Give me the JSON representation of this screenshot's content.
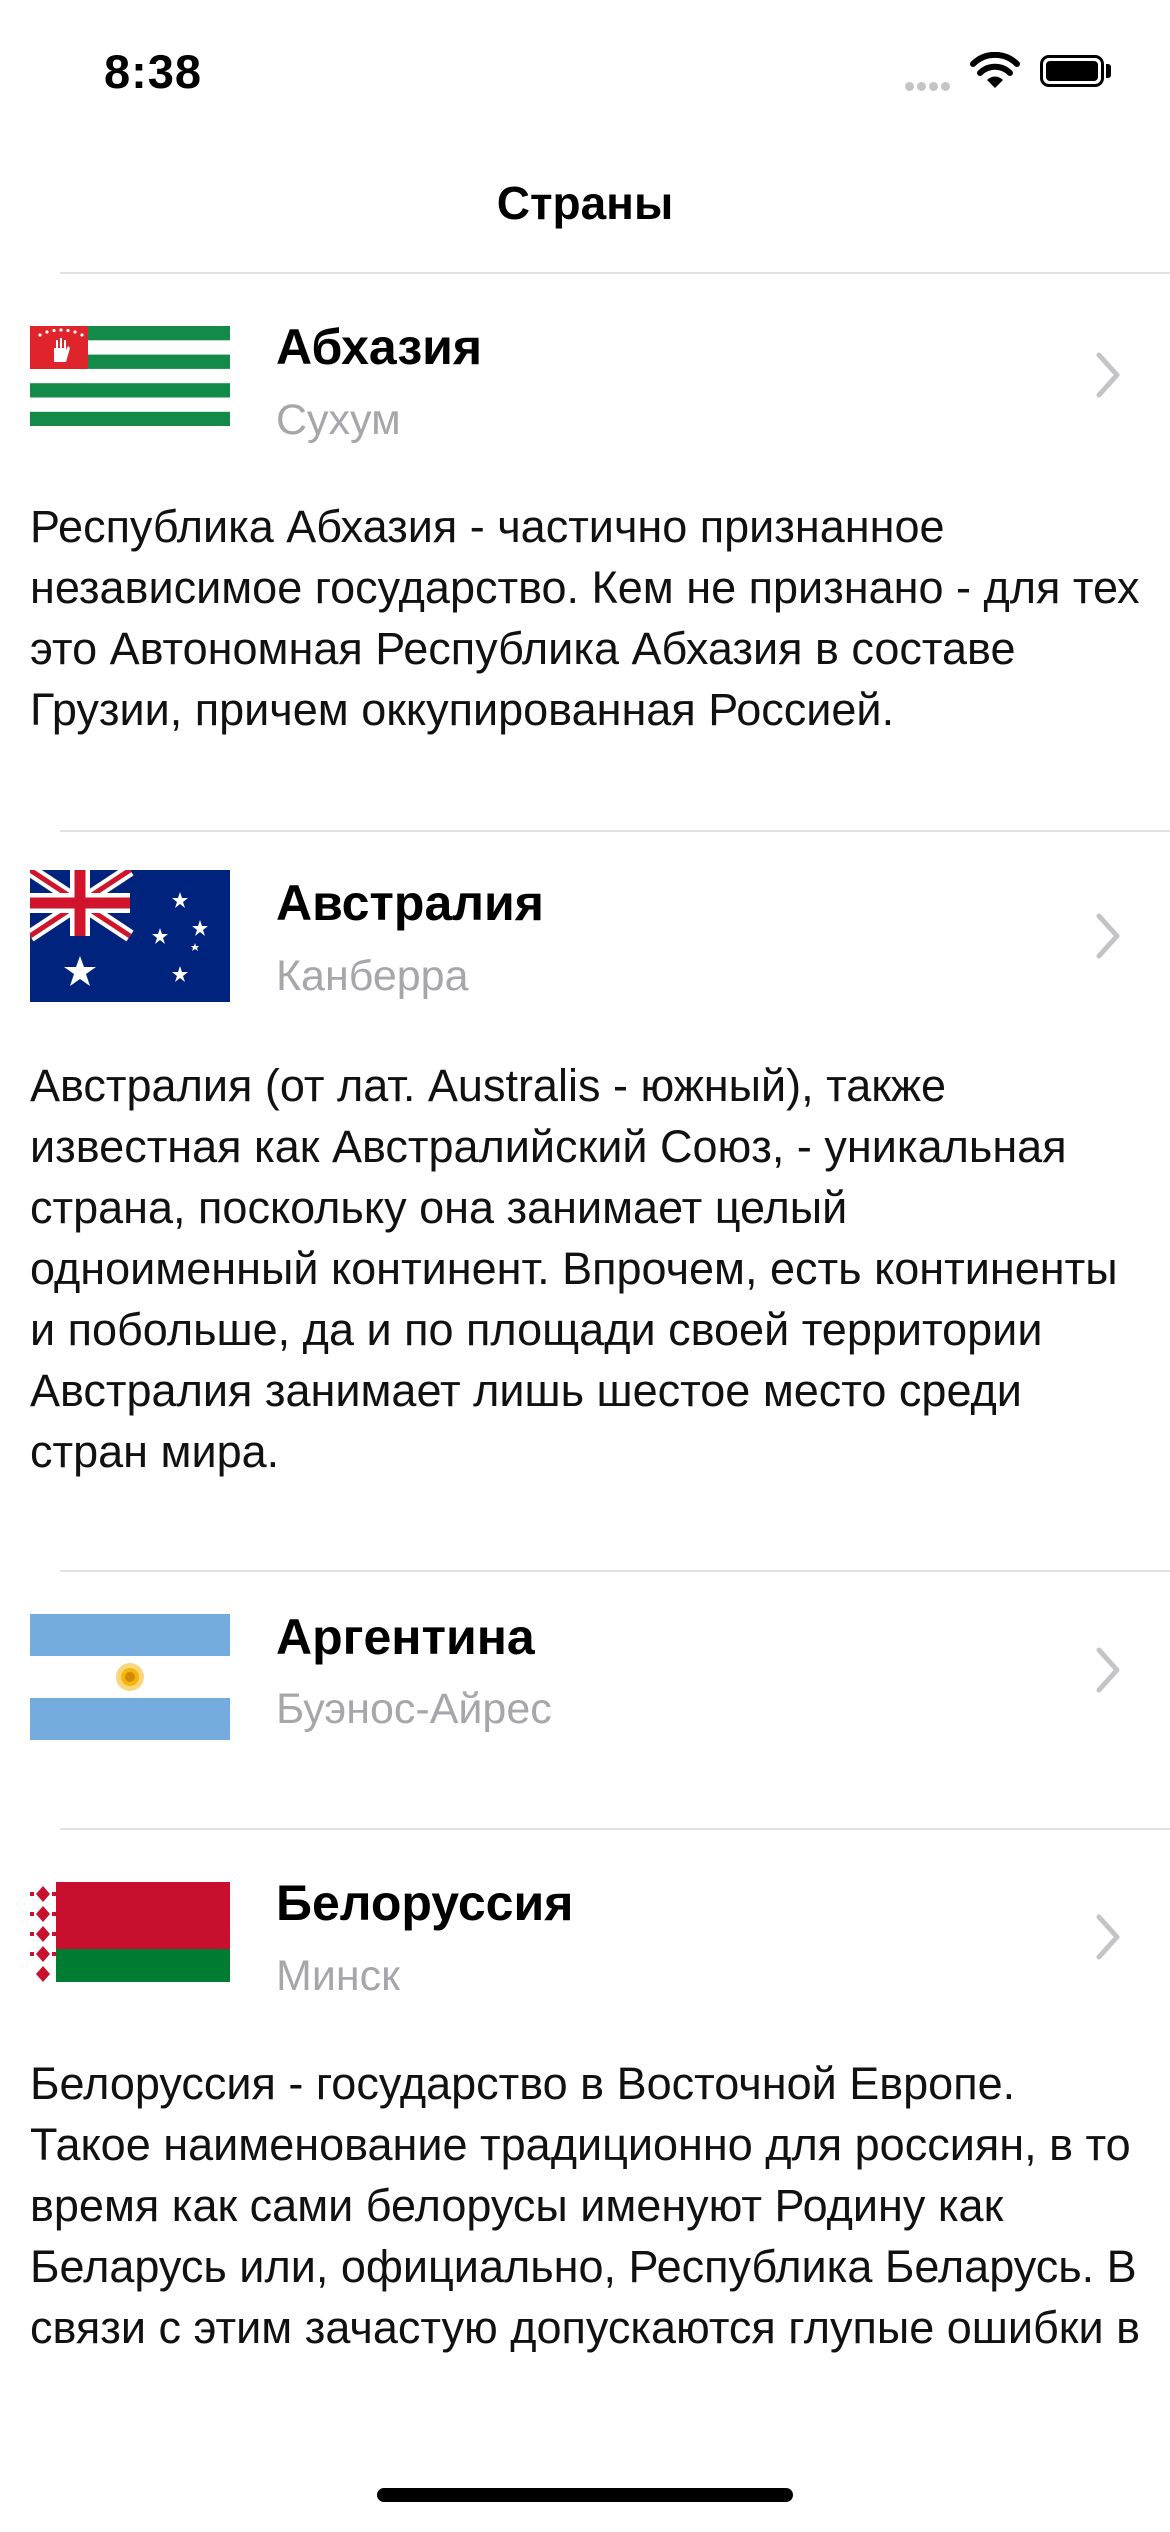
{
  "status_bar": {
    "time": "8:38"
  },
  "navigation": {
    "title": "Страны"
  },
  "countries": [
    {
      "name": "Абхазия",
      "capital": "Сухум",
      "flag_icon": "abkhazia-flag-icon",
      "description": "Республика Абхазия - частично признанное независимое государство. Кем не признано - для тех это Автономная Республика Абхазия в составе Грузии, причем оккупированная Россией."
    },
    {
      "name": "Австралия",
      "capital": "Канберра",
      "flag_icon": "australia-flag-icon",
      "description": "Австралия (от лат. Australis - южный), также известная как Австралийский Союз, - уникальная страна, поскольку она занимает целый одноименный континент. Впрочем, есть континенты и побольше, да и по площади своей территории Австралия занимает лишь шестое место среди стран мира."
    },
    {
      "name": "Аргентина",
      "capital": "Буэнос-Айрес",
      "flag_icon": "argentina-flag-icon",
      "description": ""
    },
    {
      "name": "Белоруссия",
      "capital": "Минск",
      "flag_icon": "belarus-flag-icon",
      "description": "Белоруссия - государство в Восточной Европе. Такое наименование традиционно для россиян, в то время как сами белорусы именуют Родину как Беларусь или, официально, Республика Беларусь. В связи с этим зачастую допускаются глупые ошибки в"
    }
  ],
  "colors": {
    "separator": "#e2e2e6",
    "secondary_text": "#a7a7ab",
    "chevron": "#c4c4c7",
    "abkhazia_green": "#148a48",
    "abkhazia_red": "#e0242c",
    "australia_blue": "#00247d",
    "argentina_blue": "#74acdf",
    "belarus_red": "#c8102e",
    "belarus_green": "#007c30"
  }
}
